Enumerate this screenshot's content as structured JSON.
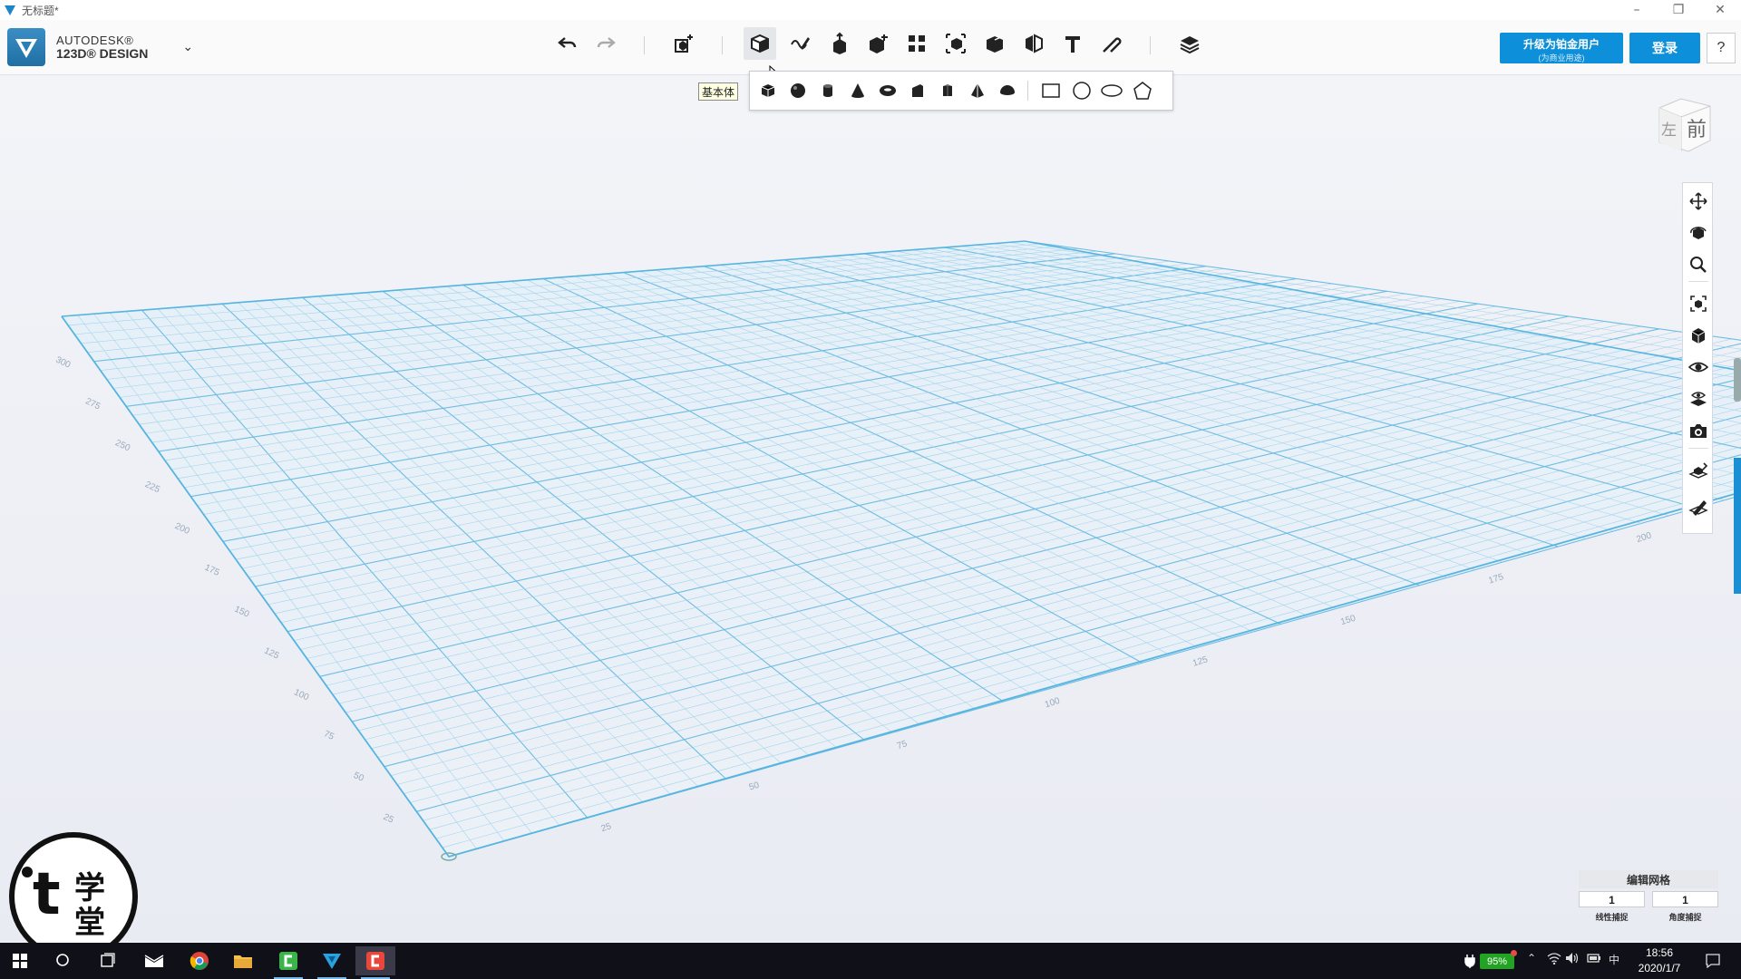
{
  "window": {
    "title": "无标题*",
    "controls": {
      "minimize": "–",
      "restore": "❐",
      "close": "✕"
    }
  },
  "brand": {
    "line1": "AUTODESK®",
    "line2": "123D® DESIGN",
    "dropdown_icon": "chevron-down-icon"
  },
  "toolbar": {
    "tools": [
      {
        "name": "undo",
        "icon": "undo-icon"
      },
      {
        "name": "redo",
        "icon": "redo-icon"
      },
      {
        "name": "transform",
        "icon": "transform-icon"
      },
      {
        "name": "primitives",
        "icon": "primitive-box-icon",
        "active": true
      },
      {
        "name": "sketch",
        "icon": "sketch-icon"
      },
      {
        "name": "construct",
        "icon": "construct-icon"
      },
      {
        "name": "modify",
        "icon": "modify-icon"
      },
      {
        "name": "pattern",
        "icon": "pattern-icon"
      },
      {
        "name": "group",
        "icon": "group-icon"
      },
      {
        "name": "combine",
        "icon": "combine-icon"
      },
      {
        "name": "measure",
        "icon": "measure-icon"
      },
      {
        "name": "text",
        "icon": "text-icon"
      },
      {
        "name": "snap",
        "icon": "snap-icon"
      },
      {
        "name": "materials",
        "icon": "materials-icon"
      }
    ],
    "tooltip": "基本体"
  },
  "primitives_tray": {
    "solids": [
      "box",
      "sphere",
      "cylinder",
      "cone",
      "torus",
      "wedge",
      "prism",
      "pyramid",
      "hemisphere"
    ],
    "sketches": [
      "rectangle",
      "circle",
      "ellipse",
      "polygon"
    ]
  },
  "account": {
    "upgrade_label": "升级为铂金用户",
    "upgrade_sub": "(为商业用途)",
    "login_label": "登录",
    "help_label": "?"
  },
  "navcube": {
    "left": "左",
    "front": "前"
  },
  "nav_tools": [
    "pan-icon",
    "orbit-icon",
    "zoom-icon",
    "fit-icon",
    "view-icon",
    "visibility-icon",
    "material-view-icon",
    "screenshot-icon",
    "grid-snap-icon",
    "pencil-icon"
  ],
  "grid_panel": {
    "title": "编辑网格",
    "snap_value": "1",
    "angle_value": "1",
    "snap_label": "线性捕捉",
    "angle_label": "角度捕捉"
  },
  "grid_labels": {
    "left_axis": [
      "25",
      "50",
      "75",
      "100",
      "125",
      "150",
      "175",
      "200",
      "225",
      "250",
      "275",
      "300"
    ],
    "front_axis": [
      "25",
      "50",
      "75",
      "100",
      "125",
      "150",
      "175",
      "200"
    ]
  },
  "watermark": {
    "letter": "t",
    "char1": "学",
    "char2": "堂"
  },
  "taskbar": {
    "apps": [
      "start-icon",
      "search-icon",
      "task-view-icon",
      "mail-icon",
      "chrome-icon",
      "file-explorer-icon",
      "camtasia-green-icon",
      "123d-design-icon",
      "camtasia-recorder-icon"
    ],
    "battery": "95%",
    "ime": "中",
    "time": "18:56",
    "date": "2020/1/7"
  }
}
